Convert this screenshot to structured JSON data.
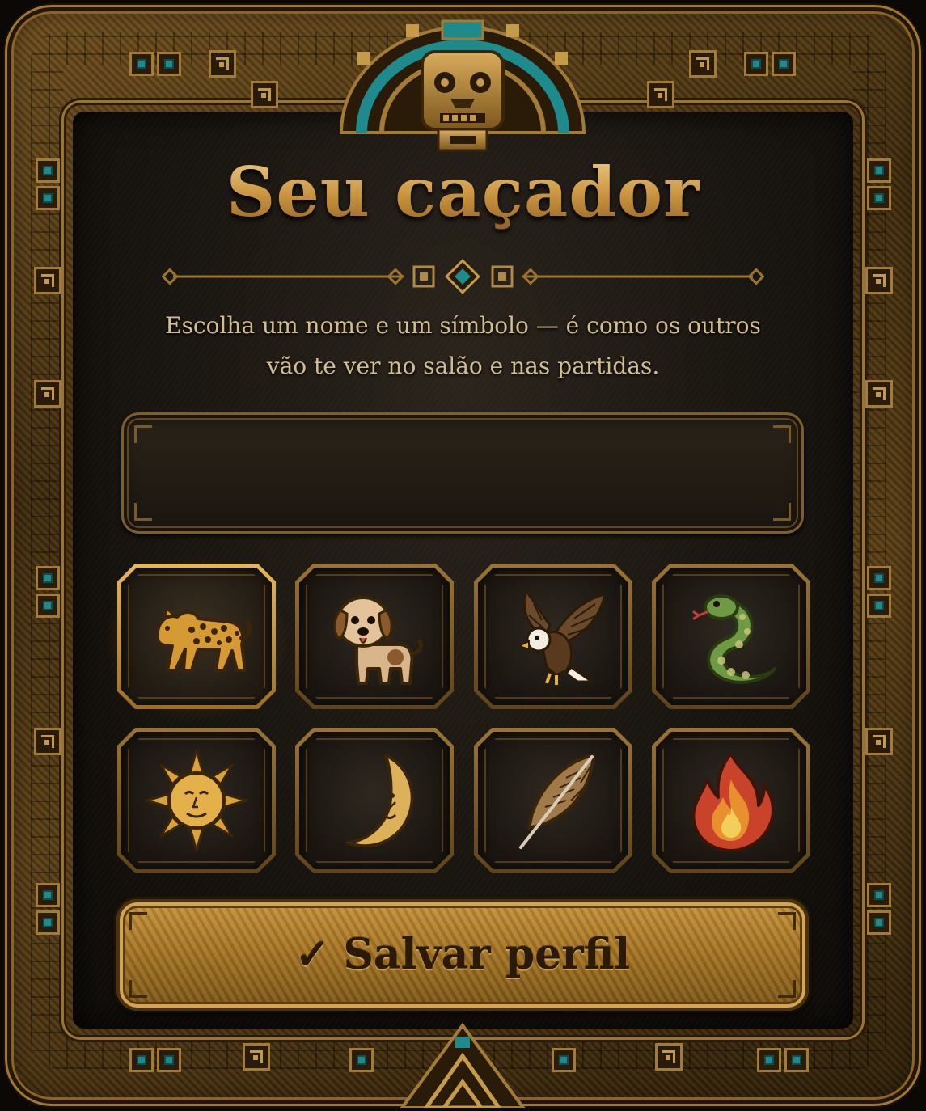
{
  "screen": {
    "title": "Seu caçador",
    "subtitle_line1": "Escolha um nome e um símbolo — é como os outros",
    "subtitle_line2": "vão te ver no salão e nas partidas."
  },
  "name_input": {
    "value": "",
    "placeholder": ""
  },
  "symbols": {
    "selected": "jaguar",
    "items": [
      {
        "id": "jaguar",
        "icon": "jaguar-icon"
      },
      {
        "id": "dog",
        "icon": "dog-icon"
      },
      {
        "id": "eagle",
        "icon": "eagle-icon"
      },
      {
        "id": "serpent",
        "icon": "serpent-icon"
      },
      {
        "id": "sun",
        "icon": "sun-icon"
      },
      {
        "id": "moon",
        "icon": "moon-icon"
      },
      {
        "id": "feather",
        "icon": "feather-icon"
      },
      {
        "id": "fire",
        "icon": "fire-icon"
      }
    ]
  },
  "actions": {
    "save_check": "✓",
    "save_label": "Salvar perfil"
  },
  "colors": {
    "gold": "#d7aa5a",
    "turquoise": "#1f8a8c",
    "panel": "#17130e",
    "button": "#a87727"
  }
}
